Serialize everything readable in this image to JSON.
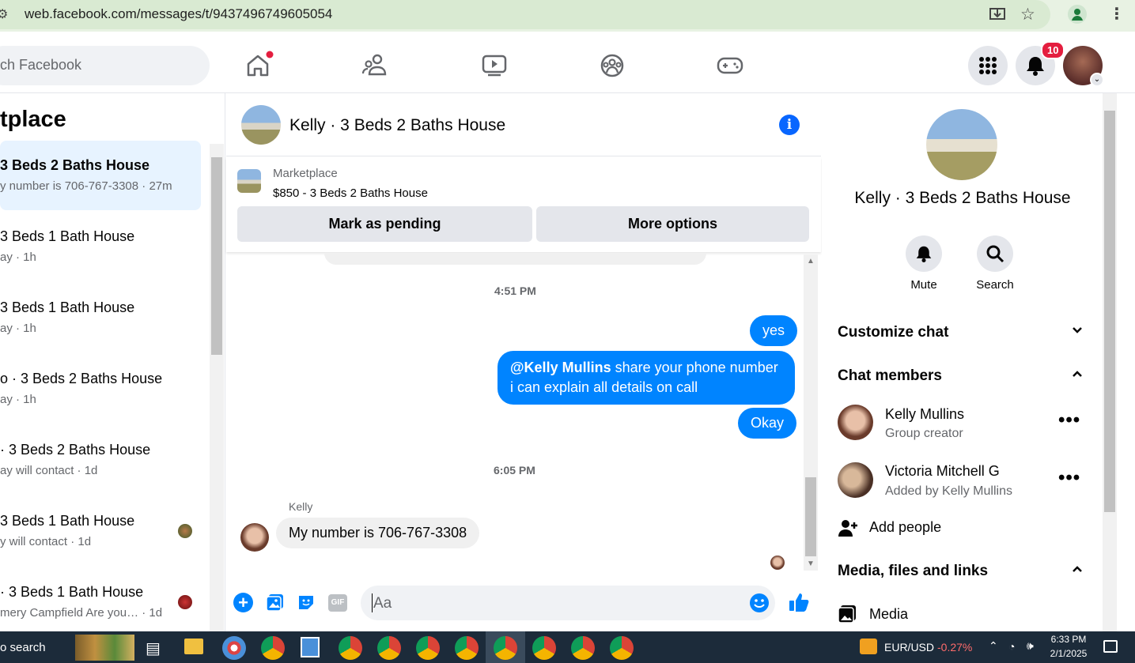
{
  "browser": {
    "url": "web.facebook.com/messages/t/9437496749605054"
  },
  "header": {
    "search_placeholder": "ch Facebook",
    "notifications_count": "10"
  },
  "left": {
    "title": "tplace",
    "conversations": [
      {
        "title": "3 Beds 2 Baths House",
        "sub": "y number is 706-767-3308 · 27m"
      },
      {
        "title": "3 Beds 1 Bath House",
        "sub": "ay · 1h"
      },
      {
        "title": "3 Beds 1 Bath House",
        "sub": "ay · 1h"
      },
      {
        "title": "o · 3 Beds 2 Baths House",
        "sub": "ay · 1h"
      },
      {
        "title": "· 3 Beds 2 Baths House",
        "sub": "ay will contact · 1d"
      },
      {
        "title": "3 Beds 1 Bath House",
        "sub": "y will contact · 1d"
      },
      {
        "title": "· 3 Beds 1 Bath House",
        "sub": "mery Campfield Are you… · 1d"
      }
    ]
  },
  "chat": {
    "title": "Kelly · 3 Beds 2 Baths House",
    "listing_source": "Marketplace",
    "listing_title": "$850 - 3 Beds 2 Baths House",
    "mark_pending": "Mark as pending",
    "more_options": "More options",
    "time1": "4:51 PM",
    "msg_yes": "yes",
    "msg_mention": "@Kelly Mullins",
    "msg_line1": " share your phone number",
    "msg_line2": "i can explain all details on call",
    "msg_okay": "Okay",
    "time2": "6:05 PM",
    "sender": "Kelly",
    "msg_in": "My number is 706-767-3308",
    "input_placeholder": "Aa"
  },
  "right": {
    "title": "Kelly · 3 Beds 2 Baths House",
    "mute": "Mute",
    "search": "Search",
    "customize": "Customize chat",
    "members_hdr": "Chat members",
    "members": [
      {
        "name": "Kelly Mullins",
        "sub": "Group creator"
      },
      {
        "name": "Victoria Mitchell G",
        "sub": "Added by Kelly Mullins"
      }
    ],
    "add_people": "Add people",
    "media_hdr": "Media, files and links",
    "media": "Media"
  },
  "taskbar": {
    "search": "o search",
    "ticker": "EUR/USD",
    "change": "-0.27%",
    "time": "6:33 PM",
    "date": "2/1/2025"
  },
  "colors": {
    "accent": "#0084ff",
    "fb_blue": "#0866ff",
    "badge": "#e41e3f",
    "taskbar": "#1c2b3a"
  }
}
